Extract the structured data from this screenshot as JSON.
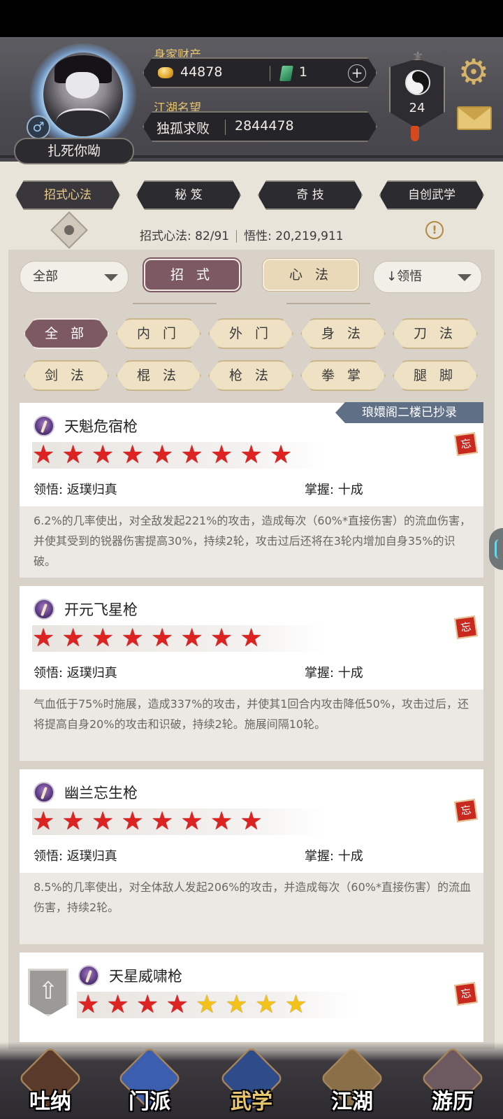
{
  "header": {
    "player_name": "扎死你呦",
    "wealth_label": "身家财产",
    "gold": "44878",
    "jade": "1",
    "plus": "+",
    "fame_label": "江湖名望",
    "fame_title": "独孤求败",
    "fame_value": "2844478",
    "level": "24",
    "gender_symbol": "♂"
  },
  "top_tabs": [
    "招式心法",
    "秘 笈",
    "奇 技",
    "自创武学"
  ],
  "stats": {
    "moves_label": "招式心法: 82/91",
    "insight_label": "悟性: 20,219,911"
  },
  "filters": {
    "all_select": "全部",
    "seg_moves": "招 式",
    "seg_mental": "心 法",
    "sort_select": "↓领悟"
  },
  "categories": [
    [
      "全 部",
      "内 门",
      "外 门",
      "身 法",
      "刀 法"
    ],
    [
      "剑 法",
      "棍 法",
      "枪 法",
      "拳 掌",
      "腿 脚"
    ]
  ],
  "copied_tag": "琅嬛阁二楼已抄录",
  "skills": [
    {
      "name": "天魁危宿枪",
      "stars_red": 9,
      "stars_gold": 0,
      "comprehension": "领悟: 返璞归真",
      "mastery": "掌握: 十成",
      "desc": "6.2%的几率使出，对全敌发起221%的攻击，造成每次（60%*直接伤害）的流血伤害，并使其受到的锐器伤害提高30%，持续2轮，攻击过后还将在3轮内增加自身35%的识破。"
    },
    {
      "name": "开元飞星枪",
      "stars_red": 8,
      "stars_gold": 0,
      "comprehension": "领悟: 返璞归真",
      "mastery": "掌握: 十成",
      "desc": "气血低于75%时施展，造成337%的攻击，并使其1回合内攻击降低50%，攻击过后，还将提高自身20%的攻击和识破，持续2轮。施展间隔10轮。"
    },
    {
      "name": "幽兰忘生枪",
      "stars_red": 8,
      "stars_gold": 0,
      "comprehension": "领悟: 返璞归真",
      "mastery": "掌握: 十成",
      "desc": "8.5%的几率使出，对全体敌人发起206%的攻击，并造成每次（60%*直接伤害）的流血伤害，持续2轮。"
    },
    {
      "name": "天星威啸枪",
      "stars_red": 4,
      "stars_gold": 4
    }
  ],
  "forget_label": "忘",
  "bottom_nav": [
    "吐纳",
    "门派",
    "武学",
    "江湖",
    "游历"
  ],
  "colors": {
    "accent_active": "#7c5963",
    "tag_blue": "#5f6f86",
    "star_red": "#dd2222",
    "star_gold": "#f2c21a"
  }
}
